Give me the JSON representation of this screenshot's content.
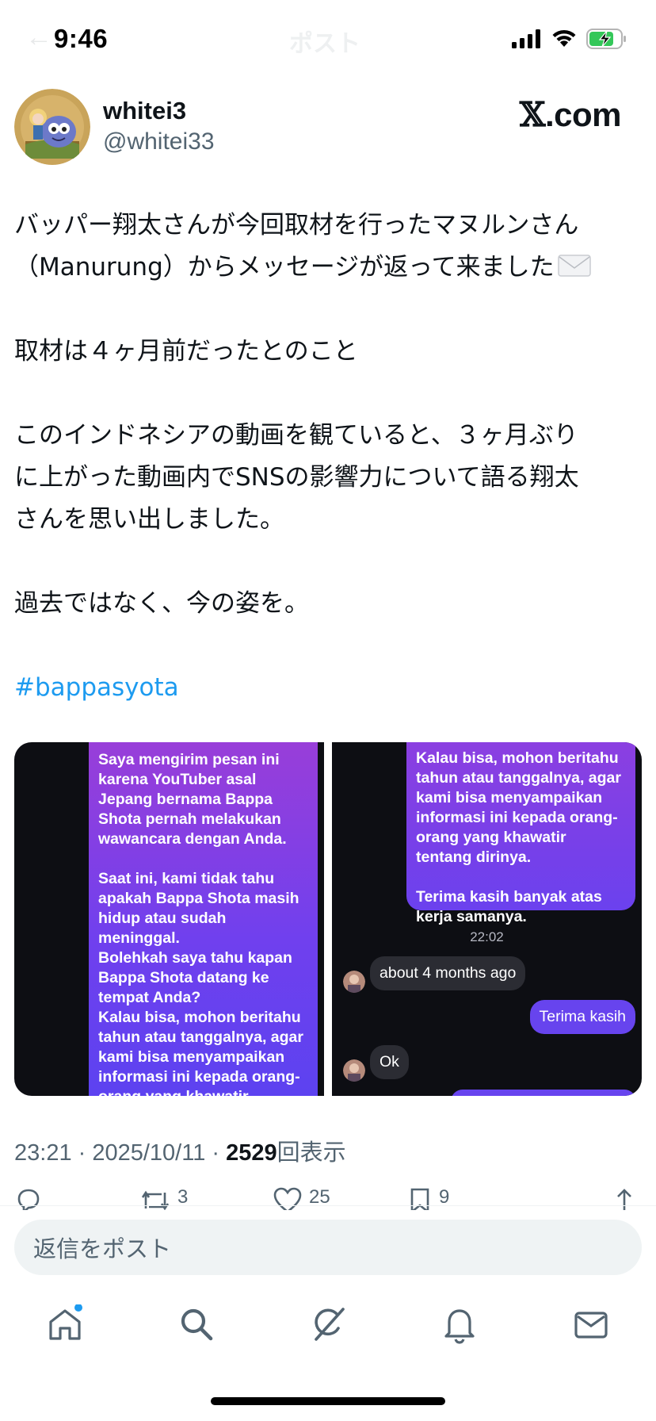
{
  "status_bar": {
    "time": "9:46",
    "faded_title": "ポスト",
    "icons": [
      "back-arrow-icon",
      "cellular-signal-icon",
      "wifi-icon",
      "battery-charging-icon"
    ],
    "battery_color": "#34c759"
  },
  "author": {
    "display_name": "whitei3",
    "handle": "@whitei33",
    "brand_x": "𝕏",
    "brand_suffix": ".com"
  },
  "tweet": {
    "lines": [
      "バッパー翔太さんが今回取材を行ったマヌルンさん",
      "（Manurung）からメッセージが返って来ました",
      "",
      "取材は４ヶ月前だったとのこと",
      "",
      "このインドネシアの動画を観ていると、３ヶ月ぶり",
      "に上がった動画内でSNSの影響力について語る翔太",
      "さんを思い出しました。",
      "",
      "過去ではなく、今の姿を。",
      ""
    ],
    "hashtag": "#bappasyota",
    "hashtag_color": "#1d9bf0"
  },
  "media": {
    "left_message": "Saya mengirim pesan ini\nkarena YouTuber asal\nJepang bernama Bappa\nShota pernah melakukan\nwawancara dengan Anda.\n\nSaat ini, kami tidak tahu\napakah Bappa Shota masih\nhidup atau sudah\nmeninggal.\nBolehkah saya tahu kapan\nBappa Shota datang ke\ntempat Anda?\nKalau bisa, mohon beritahu\ntahun atau tanggalnya, agar\nkami bisa menyampaikan\ninformasi ini kepada orang-\norang yang khawatir\ntentang dirinya.",
    "right_message": "Kalau bisa, mohon beritahu\ntahun atau tanggalnya, agar\nkami bisa menyampaikan\ninformasi ini kepada orang-\norang yang khawatir\ntentang dirinya.\n\nTerima kasih banyak atas\nkerja samanya.",
    "chat_time": "22:02",
    "reply_1": "about 4 months ago",
    "sent_1": "Terima kasih",
    "reply_2": "Ok",
    "bubble_color": "#6744ee"
  },
  "meta": {
    "time": "23:21",
    "sep1": " · ",
    "date": "2025/10/11",
    "sep2": " · ",
    "views_count": "2529",
    "views_label": "回表示"
  },
  "actions": {
    "retweets": "3",
    "likes": "25",
    "bookmarks": "9"
  },
  "reply_box": {
    "placeholder": "返信をポスト"
  },
  "nav": {
    "items": [
      "home-icon",
      "search-icon",
      "grok-icon",
      "notifications-icon",
      "messages-icon"
    ],
    "notification_dot_color": "#1d9bf0"
  }
}
